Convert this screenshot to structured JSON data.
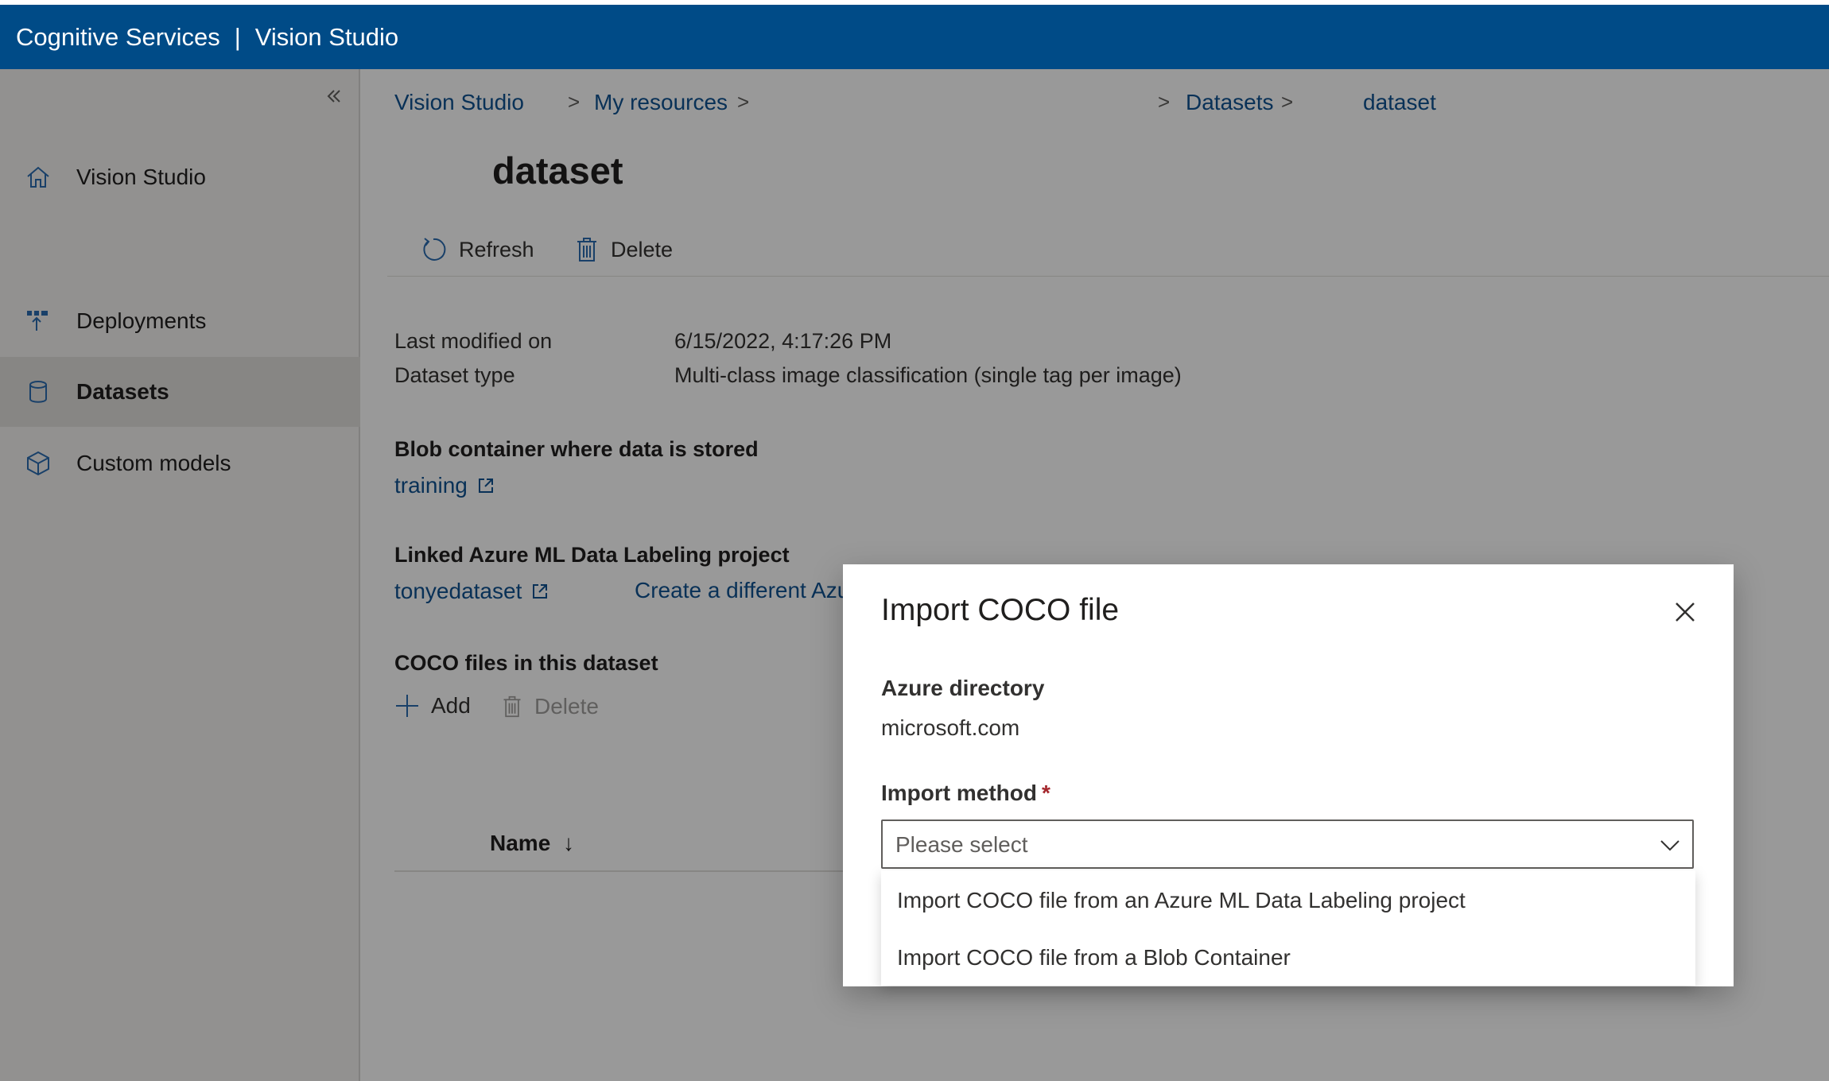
{
  "app": {
    "brand": "Cognitive Services",
    "separator": "|",
    "product": "Vision Studio"
  },
  "sidebar": {
    "items": [
      {
        "label": "Vision Studio",
        "icon": "home-icon"
      },
      {
        "label": "Deployments",
        "icon": "deployments-icon"
      },
      {
        "label": "Datasets",
        "icon": "database-icon",
        "active": true
      },
      {
        "label": "Custom models",
        "icon": "cube-icon"
      }
    ]
  },
  "breadcrumb": {
    "items": [
      "Vision Studio",
      "My resources",
      "Datasets",
      "dataset"
    ],
    "chevron": ">"
  },
  "page": {
    "title": "dataset"
  },
  "toolbar": {
    "refresh_label": "Refresh",
    "delete_label": "Delete"
  },
  "details": {
    "last_modified_label": "Last modified on",
    "last_modified_value": "6/15/2022, 4:17:26 PM",
    "dataset_type_label": "Dataset type",
    "dataset_type_value": "Multi-class image classification (single tag per image)"
  },
  "blob": {
    "heading": "Blob container where data is stored",
    "link": "training"
  },
  "labeling": {
    "heading": "Linked Azure ML Data Labeling project",
    "link": "tonyedataset",
    "create_link": "Create a different Azure ML Data Labeling project"
  },
  "coco": {
    "heading": "COCO files in this dataset",
    "add_label": "Add",
    "delete_label": "Delete",
    "column_name": "Name",
    "sort_indicator": "↓"
  },
  "dialog": {
    "title": "Import COCO file",
    "directory_label": "Azure directory",
    "directory_value": "microsoft.com",
    "method_label": "Import method",
    "required_mark": "*",
    "placeholder": "Please select",
    "options": [
      "Import COCO file from an Azure ML Data Labeling project",
      "Import COCO file from a Blob Container"
    ]
  },
  "colors": {
    "topbar": "#004b87",
    "link": "#0f5291",
    "required": "#a4262c"
  }
}
